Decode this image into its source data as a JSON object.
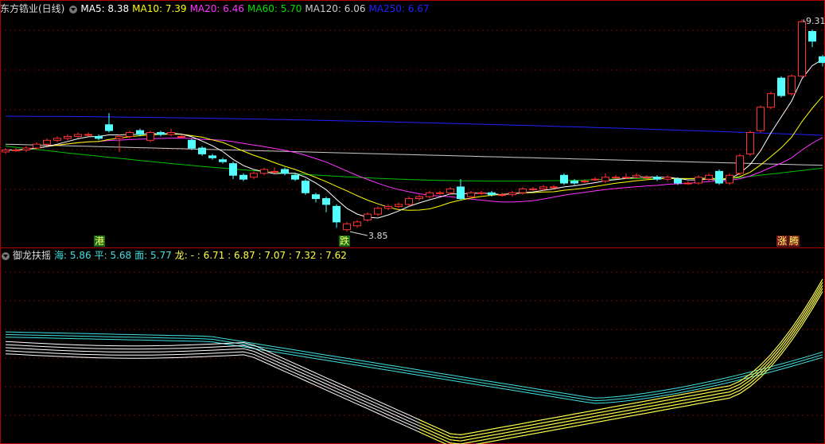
{
  "panel1": {
    "title": "东方锆业(日线)",
    "legend": [
      {
        "label": "MA5: 8.38",
        "color": "#ffffff"
      },
      {
        "label": "MA10: 7.39",
        "color": "#ffff00"
      },
      {
        "label": "MA20: 6.46",
        "color": "#ff33ff"
      },
      {
        "label": "MA60: 5.70",
        "color": "#00e000"
      },
      {
        "label": "MA120: 6.06",
        "color": "#cccccc"
      },
      {
        "label": "MA250: 6.67",
        "color": "#2020ff"
      }
    ],
    "high_label": "9.31",
    "low_label": "3.85",
    "markers": [
      "港",
      "跌",
      "涨",
      "腾"
    ]
  },
  "panel2": {
    "title": "御龙扶摇",
    "legend": [
      {
        "label": "海: 5.86",
        "color": "#40e0e0"
      },
      {
        "label": "平: 5.68",
        "color": "#40e0e0"
      },
      {
        "label": "面: 5.77",
        "color": "#40e0e0"
      },
      {
        "label": "龙: - : 6.71 : 6.87 : 7.07 : 7.32 : 7.62",
        "color": "#ffff40"
      }
    ]
  },
  "colors": {
    "up": "#ff3232",
    "down": "#54ffff",
    "grid": "#7a0000",
    "frame": "#b00000"
  },
  "chart_data": {
    "type": "candlestick",
    "candles": [
      [
        5.9,
        5.95,
        5.85,
        6.0
      ],
      [
        5.95,
        5.95,
        5.9,
        6.0
      ],
      [
        5.95,
        6.0,
        5.9,
        6.05
      ],
      [
        6.0,
        6.1,
        5.95,
        6.15
      ],
      [
        6.1,
        6.2,
        6.05,
        6.25
      ],
      [
        6.2,
        6.25,
        6.15,
        6.3
      ],
      [
        6.25,
        6.3,
        6.2,
        6.35
      ],
      [
        6.3,
        6.35,
        6.25,
        6.4
      ],
      [
        6.35,
        6.35,
        6.3,
        6.4
      ],
      [
        6.3,
        6.25,
        6.2,
        6.35
      ],
      [
        6.6,
        6.45,
        6.4,
        6.9
      ],
      [
        6.25,
        6.3,
        5.9,
        6.35
      ],
      [
        6.3,
        6.4,
        6.25,
        6.45
      ],
      [
        6.45,
        6.35,
        6.3,
        6.5
      ],
      [
        6.2,
        6.4,
        6.15,
        6.45
      ],
      [
        6.4,
        6.35,
        6.3,
        6.45
      ],
      [
        6.35,
        6.4,
        6.3,
        6.5
      ],
      [
        6.3,
        6.3,
        6.25,
        6.35
      ],
      [
        6.2,
        6.0,
        5.95,
        6.25
      ],
      [
        6.0,
        5.85,
        5.8,
        6.05
      ],
      [
        5.8,
        5.75,
        5.7,
        5.85
      ],
      [
        5.7,
        5.65,
        5.6,
        5.75
      ],
      [
        5.6,
        5.3,
        5.2,
        5.65
      ],
      [
        5.3,
        5.2,
        5.15,
        5.35
      ],
      [
        5.25,
        5.35,
        5.2,
        5.4
      ],
      [
        5.35,
        5.45,
        5.3,
        5.5
      ],
      [
        5.4,
        5.4,
        5.35,
        5.5
      ],
      [
        5.45,
        5.35,
        5.3,
        5.5
      ],
      [
        5.3,
        5.2,
        5.15,
        5.35
      ],
      [
        5.15,
        4.85,
        4.8,
        5.2
      ],
      [
        4.8,
        4.7,
        4.6,
        4.85
      ],
      [
        4.7,
        4.55,
        4.35,
        4.75
      ],
      [
        4.5,
        4.1,
        3.95,
        4.55
      ],
      [
        3.9,
        4.05,
        3.85,
        4.1
      ],
      [
        4.0,
        4.1,
        3.95,
        4.15
      ],
      [
        4.15,
        4.3,
        4.1,
        4.35
      ],
      [
        4.3,
        4.45,
        4.25,
        4.5
      ],
      [
        4.45,
        4.5,
        4.4,
        4.55
      ],
      [
        4.5,
        4.55,
        4.45,
        4.6
      ],
      [
        4.55,
        4.7,
        4.5,
        4.75
      ],
      [
        4.7,
        4.75,
        4.65,
        4.8
      ],
      [
        4.75,
        4.85,
        4.7,
        4.9
      ],
      [
        4.85,
        4.85,
        4.8,
        4.9
      ],
      [
        4.85,
        4.95,
        4.8,
        5.0
      ],
      [
        5.0,
        4.7,
        4.65,
        5.2
      ],
      [
        4.75,
        4.85,
        4.7,
        4.9
      ],
      [
        4.85,
        4.85,
        4.8,
        4.9
      ],
      [
        4.85,
        4.8,
        4.75,
        4.9
      ],
      [
        4.8,
        4.8,
        4.75,
        4.85
      ],
      [
        4.8,
        4.85,
        4.75,
        4.9
      ],
      [
        4.85,
        4.95,
        4.8,
        5.0
      ],
      [
        4.95,
        4.95,
        4.9,
        5.0
      ],
      [
        4.95,
        5.0,
        4.9,
        5.05
      ],
      [
        5.0,
        5.0,
        4.95,
        5.05
      ],
      [
        5.3,
        5.1,
        5.05,
        5.35
      ],
      [
        5.15,
        5.1,
        5.05,
        5.2
      ],
      [
        5.15,
        5.15,
        5.1,
        5.2
      ],
      [
        5.2,
        5.2,
        5.15,
        5.25
      ],
      [
        5.15,
        5.25,
        5.1,
        5.35
      ],
      [
        5.25,
        5.25,
        5.2,
        5.3
      ],
      [
        5.25,
        5.25,
        5.2,
        5.35
      ],
      [
        5.25,
        5.3,
        5.2,
        5.35
      ],
      [
        5.25,
        5.25,
        5.2,
        5.3
      ],
      [
        5.25,
        5.2,
        5.15,
        5.3
      ],
      [
        5.2,
        5.25,
        5.15,
        5.3
      ],
      [
        5.2,
        5.1,
        5.05,
        5.25
      ],
      [
        5.1,
        5.1,
        5.05,
        5.15
      ],
      [
        5.1,
        5.25,
        5.05,
        5.3
      ],
      [
        5.2,
        5.3,
        5.15,
        5.35
      ],
      [
        5.4,
        5.1,
        5.05,
        5.45
      ],
      [
        5.1,
        5.3,
        5.05,
        5.35
      ],
      [
        5.35,
        5.8,
        5.3,
        5.85
      ],
      [
        5.85,
        6.4,
        5.8,
        6.45
      ],
      [
        6.45,
        7.05,
        6.4,
        7.1
      ],
      [
        7.05,
        7.4,
        7.0,
        7.45
      ],
      [
        7.8,
        7.35,
        7.3,
        7.85
      ],
      [
        7.4,
        7.85,
        7.35,
        7.9
      ],
      [
        7.85,
        9.25,
        7.8,
        9.31
      ],
      [
        9.0,
        8.75,
        8.6,
        9.05
      ],
      [
        8.35,
        8.2,
        8.1,
        8.4
      ]
    ],
    "ylim": [
      3.75,
      9.4
    ],
    "indicator_ylim": [
      3.9,
      8.0
    ]
  }
}
